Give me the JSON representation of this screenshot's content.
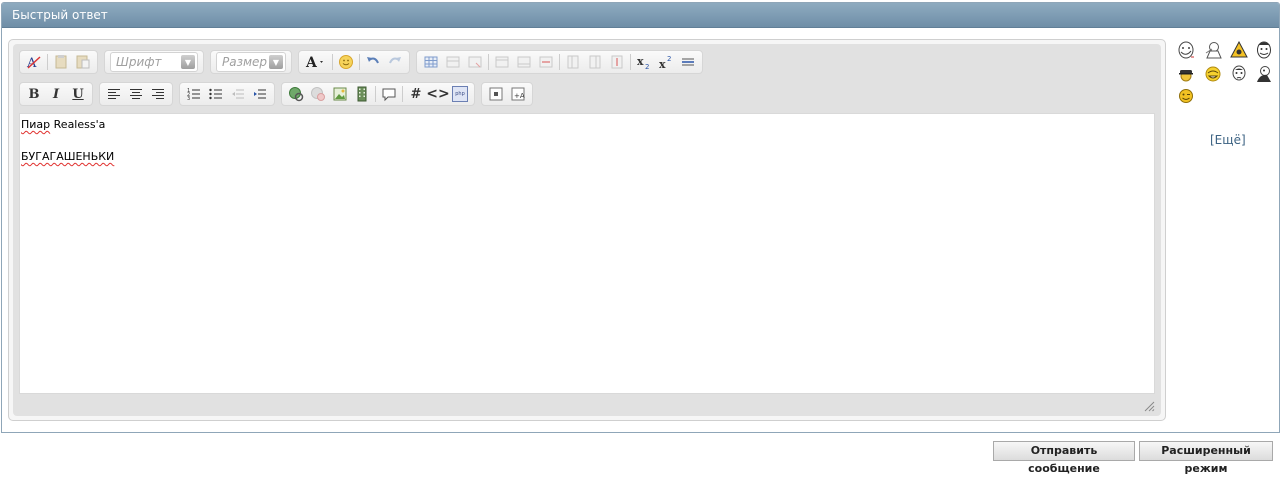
{
  "panel": {
    "title": "Быстрый ответ"
  },
  "toolbar": {
    "font_combo_label": "Шрифт",
    "size_combo_label": "Размер",
    "hash_glyph": "#",
    "code_glyph": "<>",
    "php_glyph": "php"
  },
  "editor": {
    "lines": [
      {
        "segments": [
          {
            "text": "Пиар",
            "misspelled": true
          },
          {
            "text": " Realess'a",
            "misspelled": false
          }
        ]
      },
      {
        "segments": []
      },
      {
        "segments": [
          {
            "text": "БУГАГАШЕНЬКИ",
            "misspelled": true
          }
        ]
      }
    ]
  },
  "smilies": {
    "icons": [
      "troll-face-icon",
      "cereal-guy-icon",
      "warning-sign-icon",
      "yao-ming-icon",
      "spy-smiley-icon",
      "yellow-grin-icon",
      "forever-alone-icon",
      "rage-guy-icon",
      "yellow-wink-icon"
    ],
    "more_label": "[Ещё]"
  },
  "actions": {
    "submit_label": "Отправить сообщение",
    "advanced_label": "Расширенный режим"
  },
  "colors": {
    "header": "#7f9cb3",
    "link": "#3d6383",
    "misspelling": "#e0302e"
  }
}
